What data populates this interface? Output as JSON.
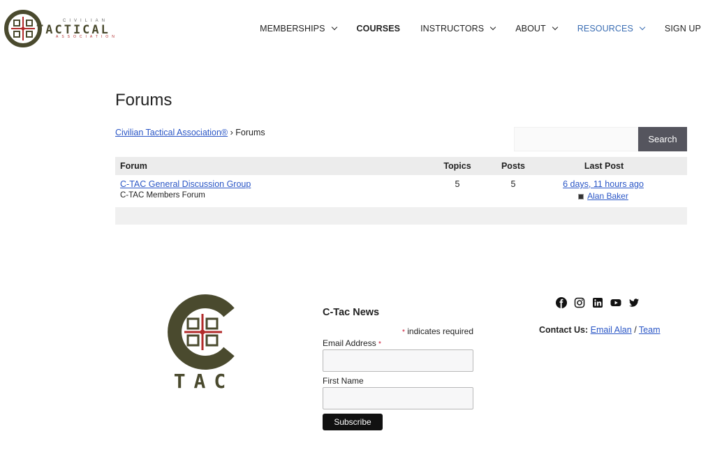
{
  "header": {
    "logo_wordmark": "TACTICAL",
    "logo_top": "CIVILIAN",
    "logo_bottom": "ASSOCIATION",
    "nav": [
      {
        "label": "MEMBERSHIPS",
        "dropdown": true
      },
      {
        "label": "COURSES",
        "dropdown": false
      },
      {
        "label": "INSTRUCTORS",
        "dropdown": true
      },
      {
        "label": "ABOUT",
        "dropdown": true
      },
      {
        "label": "RESOURCES",
        "dropdown": true
      },
      {
        "label": "SIGN UP",
        "dropdown": false
      }
    ]
  },
  "main": {
    "title": "Forums",
    "breadcrumb": {
      "home": "Civilian Tactical Association®",
      "separator": "›",
      "current": "Forums"
    },
    "search": {
      "placeholder": "",
      "button": "Search"
    },
    "table": {
      "headers": {
        "forum": "Forum",
        "topics": "Topics",
        "posts": "Posts",
        "last_post": "Last Post"
      },
      "rows": [
        {
          "title": "C-TAC General Discussion Group",
          "description": "C-TAC Members Forum",
          "topics": "5",
          "posts": "5",
          "last_time": "6 days, 11 hours ago",
          "last_author": "Alan Baker"
        }
      ]
    }
  },
  "footer": {
    "logo_text": "TAC",
    "news_title": "C-Tac News",
    "required_note": "indicates required",
    "asterisk": "*",
    "email_label": "Email Address",
    "first_name_label": "First Name",
    "subscribe": "Subscribe",
    "social_icons": [
      "facebook-icon",
      "instagram-icon",
      "linkedin-icon",
      "youtube-icon",
      "twitter-icon"
    ],
    "contact_label": "Contact Us:",
    "contact_email": "Email Alan",
    "contact_sep": "/",
    "contact_team": "Team"
  },
  "colors": {
    "brand_olive": "#4a4a2e",
    "brand_red": "#b22a2a",
    "link": "#2a56c6",
    "nav_active": "#3a6db3",
    "search_button": "#55555e"
  }
}
